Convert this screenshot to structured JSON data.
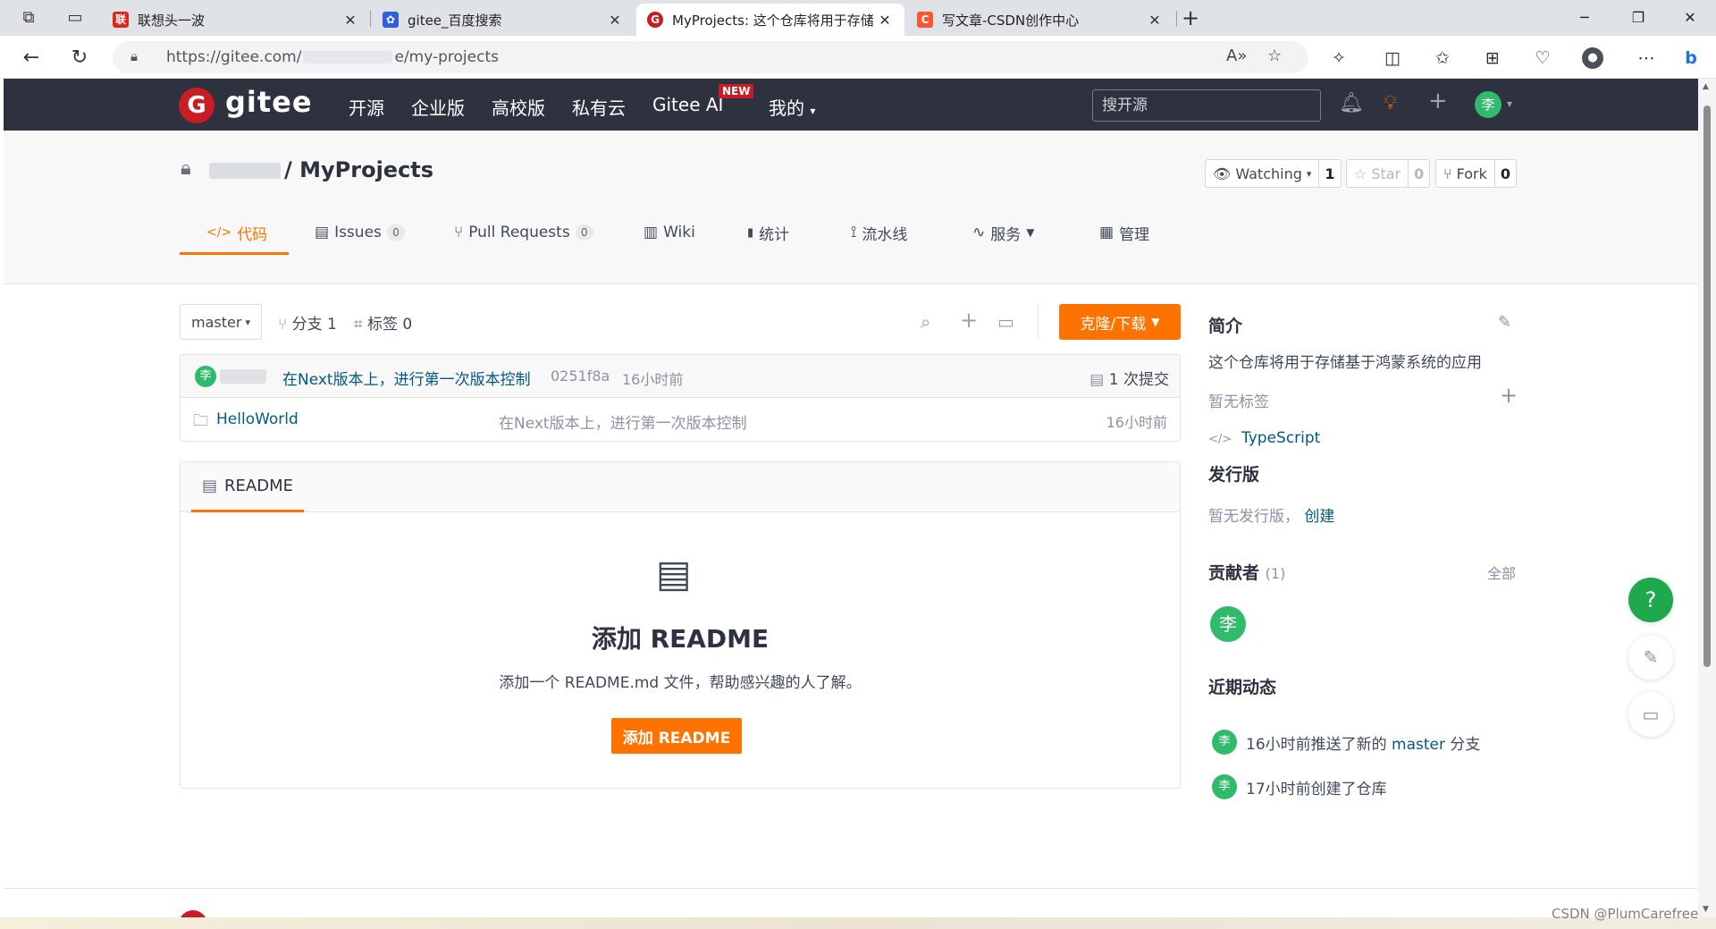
{
  "browser": {
    "tabs": [
      {
        "title": "联想头一波",
        "fav": "联",
        "fav_color": "#e1251b"
      },
      {
        "title": "gitee_百度搜索",
        "fav": "✿",
        "fav_color": "#2f5fdb"
      },
      {
        "title": "MyProjects: 这个仓库将用于存储",
        "fav": "G",
        "fav_color": "#c71d23"
      },
      {
        "title": "写文章-CSDN创作中心",
        "fav": "C",
        "fav_color": "#fc5531"
      }
    ],
    "url": "https://gitee.com/",
    "url_suffix": "e/my-projects"
  },
  "gitee": {
    "logo_text": "gitee",
    "nav": [
      "开源",
      "企业版",
      "高校版",
      "私有云",
      "Gitee AI",
      "我的"
    ],
    "new_badge": "NEW",
    "search_placeholder": "搜开源",
    "avatar_char": "李"
  },
  "repo": {
    "name": "/ MyProjects",
    "watching_label": "Watching",
    "watching_count": "1",
    "star_label": "Star",
    "star_count": "0",
    "fork_label": "Fork",
    "fork_count": "0",
    "tabs": [
      {
        "label": "代码",
        "icon": "</>"
      },
      {
        "label": "Issues",
        "badge": "0",
        "icon": "▤"
      },
      {
        "label": "Pull Requests",
        "badge": "0",
        "icon": "⑂"
      },
      {
        "label": "Wiki",
        "icon": "▥"
      },
      {
        "label": "统计",
        "icon": "▮"
      },
      {
        "label": "流水线",
        "icon": "⟟"
      },
      {
        "label": "服务",
        "icon": "∿"
      },
      {
        "label": "管理",
        "icon": "▦"
      }
    ]
  },
  "branch": {
    "current": "master",
    "branches": "分支 1",
    "tags": "标签 0",
    "clone_label": "克隆/下载"
  },
  "commit": {
    "avatar": "李",
    "message": "在Next版本上，进行第一次版本控制",
    "hash": "0251f8a",
    "time": "16小时前",
    "count": "1 次提交"
  },
  "files": [
    {
      "name": "HelloWorld",
      "message": "在Next版本上，进行第一次版本控制",
      "time": "16小时前"
    }
  ],
  "readme": {
    "tab": "README",
    "title": "添加 README",
    "desc": "添加一个 README.md 文件，帮助感兴趣的人了解。",
    "button": "添加 README"
  },
  "sidebar": {
    "intro_title": "简介",
    "intro_text": "这个仓库将用于存储基于鸿蒙系统的应用",
    "no_tags": "暂无标签",
    "language": "TypeScript",
    "release_title": "发行版",
    "no_release": "暂无发行版，",
    "create": "创建",
    "contrib_title": "贡献者",
    "contrib_count": "(1)",
    "all": "全部",
    "contrib_avatar": "李",
    "activity_title": "近期动态",
    "activities": [
      {
        "avatar": "李",
        "pre": "16小时前推送了新的",
        "link": "master",
        "post": "分支"
      },
      {
        "avatar": "李",
        "pre": "17小时前创建了仓库",
        "link": "",
        "post": ""
      }
    ]
  },
  "floating": {
    "help": "?"
  },
  "watermark": "CSDN @PlumCarefree",
  "colors": {
    "accent": "#fe7300",
    "header": "#2e323e",
    "brand": "#c71d23",
    "link": "#005980",
    "avatar": "#30ba6b"
  }
}
